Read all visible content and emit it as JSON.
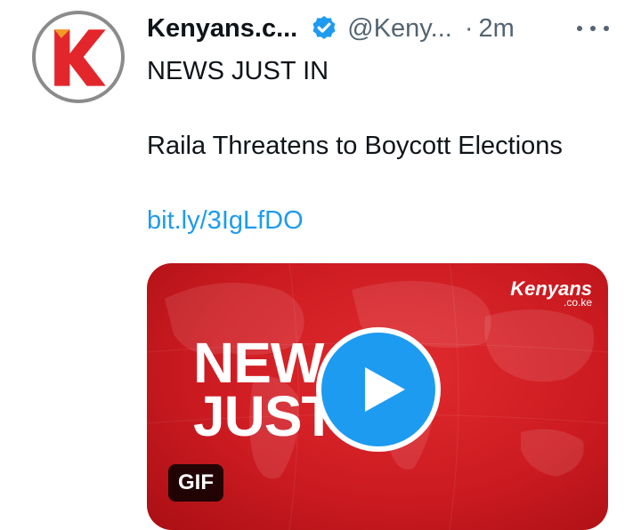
{
  "tweet": {
    "author_name": "Kenyans.c...",
    "handle": "@Keny...",
    "separator": "·",
    "time": "2m",
    "more_icon": "more-icon",
    "verified_icon": "verified-badge-icon",
    "line1": "NEWS JUST IN",
    "line2": "Raila Threatens to Boycott Elections",
    "link": "bit.ly/3IgLfDO"
  },
  "media": {
    "type": "GIF",
    "brand_top": "Kenyans",
    "brand_bottom": ".co.ke",
    "headline_line1": "NEW",
    "headline_line2": "JUST",
    "badge": "GIF"
  },
  "colors": {
    "link": "#1d9bf0",
    "verified": "#1d9bf0",
    "media_red": "#d41f25",
    "play_button": "#1d9bf0"
  }
}
